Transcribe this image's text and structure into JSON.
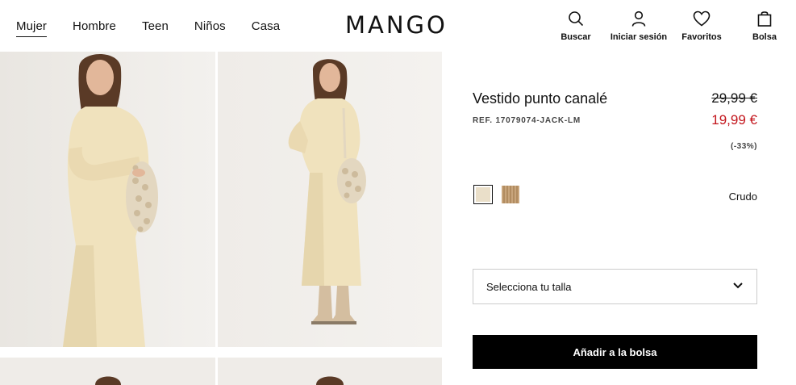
{
  "header": {
    "nav": [
      {
        "label": "Mujer",
        "active": true
      },
      {
        "label": "Hombre"
      },
      {
        "label": "Teen"
      },
      {
        "label": "Niños"
      },
      {
        "label": "Casa"
      }
    ],
    "logo": "MANGO",
    "actions": [
      {
        "label": "Buscar",
        "icon": "search-icon"
      },
      {
        "label": "Iniciar sesión",
        "icon": "user-icon"
      },
      {
        "label": "Favoritos",
        "icon": "heart-icon"
      },
      {
        "label": "Bolsa",
        "icon": "bag-icon"
      }
    ]
  },
  "product": {
    "title": "Vestido punto canalé",
    "ref": "REF. 17079074-JACK-LM",
    "old_price": "29,99 €",
    "new_price": "19,99 €",
    "discount": "(-33%)",
    "color_name": "Crudo",
    "swatches": [
      "crudo",
      "beige"
    ],
    "size_placeholder": "Selecciona tu talla",
    "add_to_bag": "Añadir a la bolsa"
  },
  "colors": {
    "sale_red": "#c3151c",
    "button_black": "#000000",
    "dress_cream": "#f0e2bd",
    "photo_bg": "#efece8"
  }
}
